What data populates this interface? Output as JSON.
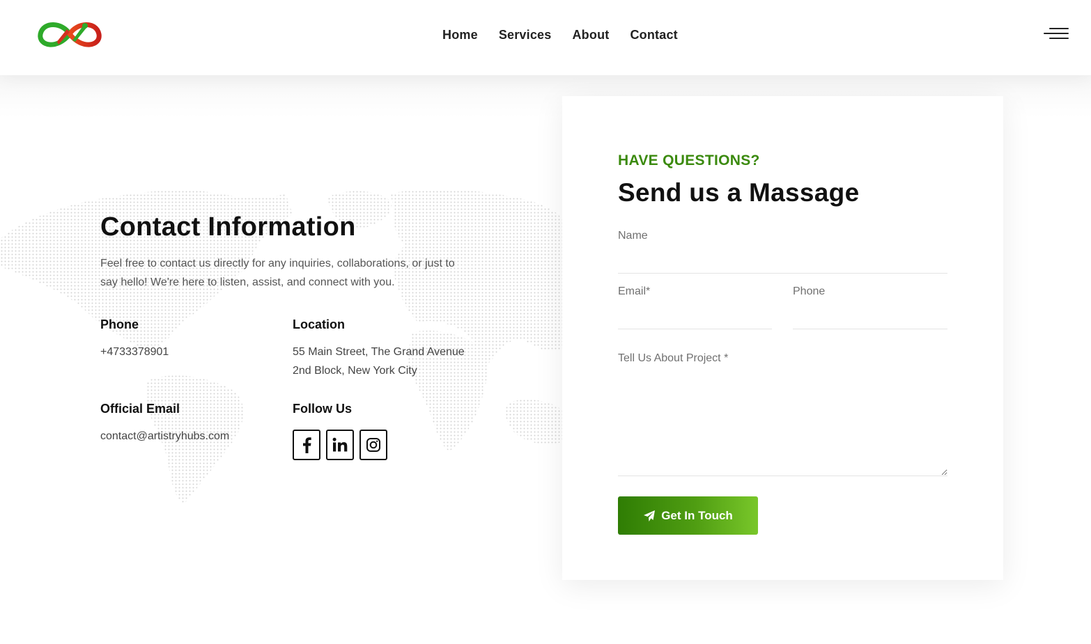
{
  "header": {
    "logo_name": "infinity-brush-logo",
    "nav": [
      {
        "label": "Home"
      },
      {
        "label": "Services"
      },
      {
        "label": "About"
      },
      {
        "label": "Contact"
      }
    ],
    "menu_icon": "hamburger-menu-icon"
  },
  "contact_info": {
    "title": "Contact Information",
    "description": "Feel free to contact us directly for any inquiries, collaborations, or just to say hello! We're here to listen, assist, and connect with you.",
    "phone": {
      "label": "Phone",
      "value": "+4733378901"
    },
    "location": {
      "label": "Location",
      "value": "55 Main Street, The Grand Avenue 2nd Block, New York City"
    },
    "email": {
      "label": "Official Email",
      "value": "contact@artistryhubs.com"
    },
    "follow": {
      "label": "Follow Us",
      "icons": [
        "facebook-icon",
        "linkedin-icon",
        "instagram-icon"
      ]
    }
  },
  "form": {
    "eyebrow": "HAVE QUESTIONS?",
    "title": "Send us a Massage",
    "name_placeholder": "Name",
    "email_placeholder": "Email*",
    "phone_placeholder": "Phone",
    "project_placeholder": "Tell Us About Project *",
    "submit_label": "Get In Touch",
    "submit_icon": "paper-plane-icon"
  },
  "colors": {
    "accent_green": "#3b8a0e",
    "button_gradient_start": "#2f7d04",
    "button_gradient_end": "#79c72a",
    "logo_green": "#2eaa2a",
    "logo_red": "#d32f1f"
  }
}
